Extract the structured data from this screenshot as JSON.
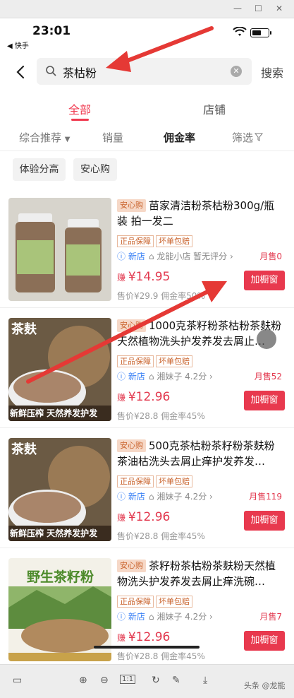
{
  "status": {
    "time": "23:01",
    "back_app": "◀ 快手"
  },
  "search": {
    "query": "茶枯粉",
    "button": "搜索"
  },
  "tabs": [
    "全部",
    "店铺"
  ],
  "sort": [
    "综合推荐",
    "销量",
    "佣金率",
    "筛选"
  ],
  "chips": [
    "体验分高",
    "安心购"
  ],
  "items": [
    {
      "tag": "安心购",
      "title": "苗家清洁粉茶枯粉300g/瓶装 拍一发二",
      "badges": [
        "正品保障",
        "坏单包赔"
      ],
      "new": "新店",
      "shop": "龙能小店 暂无评分",
      "sold": "月售0",
      "earn_prefix": "赚",
      "price": "¥14.95",
      "sub": "售价¥29.9  佣金率50%",
      "btn": "加橱窗"
    },
    {
      "tag": "安心购",
      "title": "1000克茶籽粉茶枯粉茶麸粉天然植物洗头护发养发去屑止…",
      "badges": [
        "正品保障",
        "坏单包赔"
      ],
      "new": "新店",
      "shop": "湘妹子 4.2分",
      "sold": "月售52",
      "earn_prefix": "赚",
      "price": "¥12.96",
      "sub": "售价¥28.8  佣金率45%",
      "btn": "加橱窗",
      "img_text": [
        "茶麸",
        "新鲜压榨  天然养发护发"
      ]
    },
    {
      "tag": "安心购",
      "title": "500克茶枯粉茶籽粉茶麸粉茶油枯洗头去屑止痒护发养发…",
      "badges": [
        "正品保障",
        "坏单包赔"
      ],
      "new": "新店",
      "shop": "湘妹子 4.2分",
      "sold": "月售119",
      "earn_prefix": "赚",
      "price": "¥12.96",
      "sub": "售价¥28.8  佣金率45%",
      "btn": "加橱窗",
      "img_text": [
        "茶麸",
        "新鲜压榨  天然养发护发"
      ]
    },
    {
      "tag": "安心购",
      "title": "茶籽粉茶枯粉茶麸粉天然植物洗头护发养发去屑止痒洗碗…",
      "badges": [
        "正品保障",
        "坏单包赔"
      ],
      "new": "新店",
      "shop": "湘妹子 4.2分",
      "sold": "月售7",
      "earn_prefix": "赚",
      "price": "¥12.96",
      "sub": "售价¥28.8  佣金率45%",
      "btn": "加橱窗",
      "img_text": [
        "野生茶籽粉"
      ]
    }
  ],
  "toolbar": {
    "zoom_reset": "1:1"
  },
  "watermark": "头条 @龙能",
  "colors": {
    "accent": "#e8394e",
    "tag_bg": "#f6d8c7",
    "arrow": "#e53935"
  }
}
